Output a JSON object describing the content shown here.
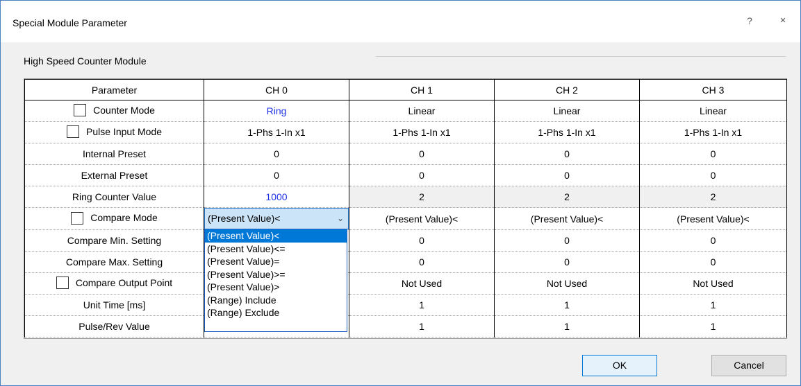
{
  "window": {
    "title": "Special Module Parameter",
    "help_glyph": "?",
    "close_glyph": "×"
  },
  "group": {
    "label": "High Speed Counter Module"
  },
  "grid": {
    "headers": [
      "Parameter",
      "CH 0",
      "CH 1",
      "CH 2",
      "CH 3"
    ],
    "rows": [
      {
        "label": "Counter Mode",
        "checkbox": true,
        "values": [
          "Ring",
          "Linear",
          "Linear",
          "Linear"
        ]
      },
      {
        "label": "Pulse Input Mode",
        "checkbox": true,
        "values": [
          "1-Phs 1-In x1",
          "1-Phs 1-In x1",
          "1-Phs 1-In x1",
          "1-Phs 1-In x1"
        ]
      },
      {
        "label": "Internal Preset",
        "checkbox": false,
        "values": [
          "0",
          "0",
          "0",
          "0"
        ]
      },
      {
        "label": "External Preset",
        "checkbox": false,
        "values": [
          "0",
          "0",
          "0",
          "0"
        ]
      },
      {
        "label": "Ring Counter Value",
        "checkbox": false,
        "values": [
          "1000",
          "2",
          "2",
          "2"
        ]
      },
      {
        "label": "Compare Mode",
        "checkbox": true,
        "values": [
          "(Present Value)<",
          "(Present Value)<",
          "(Present Value)<",
          "(Present Value)<"
        ]
      },
      {
        "label": "Compare Min. Setting",
        "checkbox": false,
        "values": [
          "",
          "0",
          "0",
          "0"
        ]
      },
      {
        "label": "Compare Max. Setting",
        "checkbox": false,
        "values": [
          "",
          "0",
          "0",
          "0"
        ]
      },
      {
        "label": "Compare Output Point",
        "checkbox": true,
        "values": [
          "",
          "Not Used",
          "Not Used",
          "Not Used"
        ]
      },
      {
        "label": "Unit Time [ms]",
        "checkbox": false,
        "values": [
          "",
          "1",
          "1",
          "1"
        ]
      },
      {
        "label": "Pulse/Rev Value",
        "checkbox": false,
        "values": [
          "",
          "1",
          "1",
          "1"
        ]
      }
    ]
  },
  "dropdown": {
    "selected": "(Present Value)<",
    "options": [
      "(Present Value)<",
      "(Present Value)<=",
      "(Present Value)=",
      "(Present Value)>=",
      "(Present Value)>",
      "(Range) Include",
      "(Range) Exclude"
    ]
  },
  "buttons": {
    "ok": "OK",
    "cancel": "Cancel"
  },
  "colors": {
    "changed_value": "#1f31e8",
    "selection": "#0078d7",
    "combo_bg": "#cce4f7"
  }
}
